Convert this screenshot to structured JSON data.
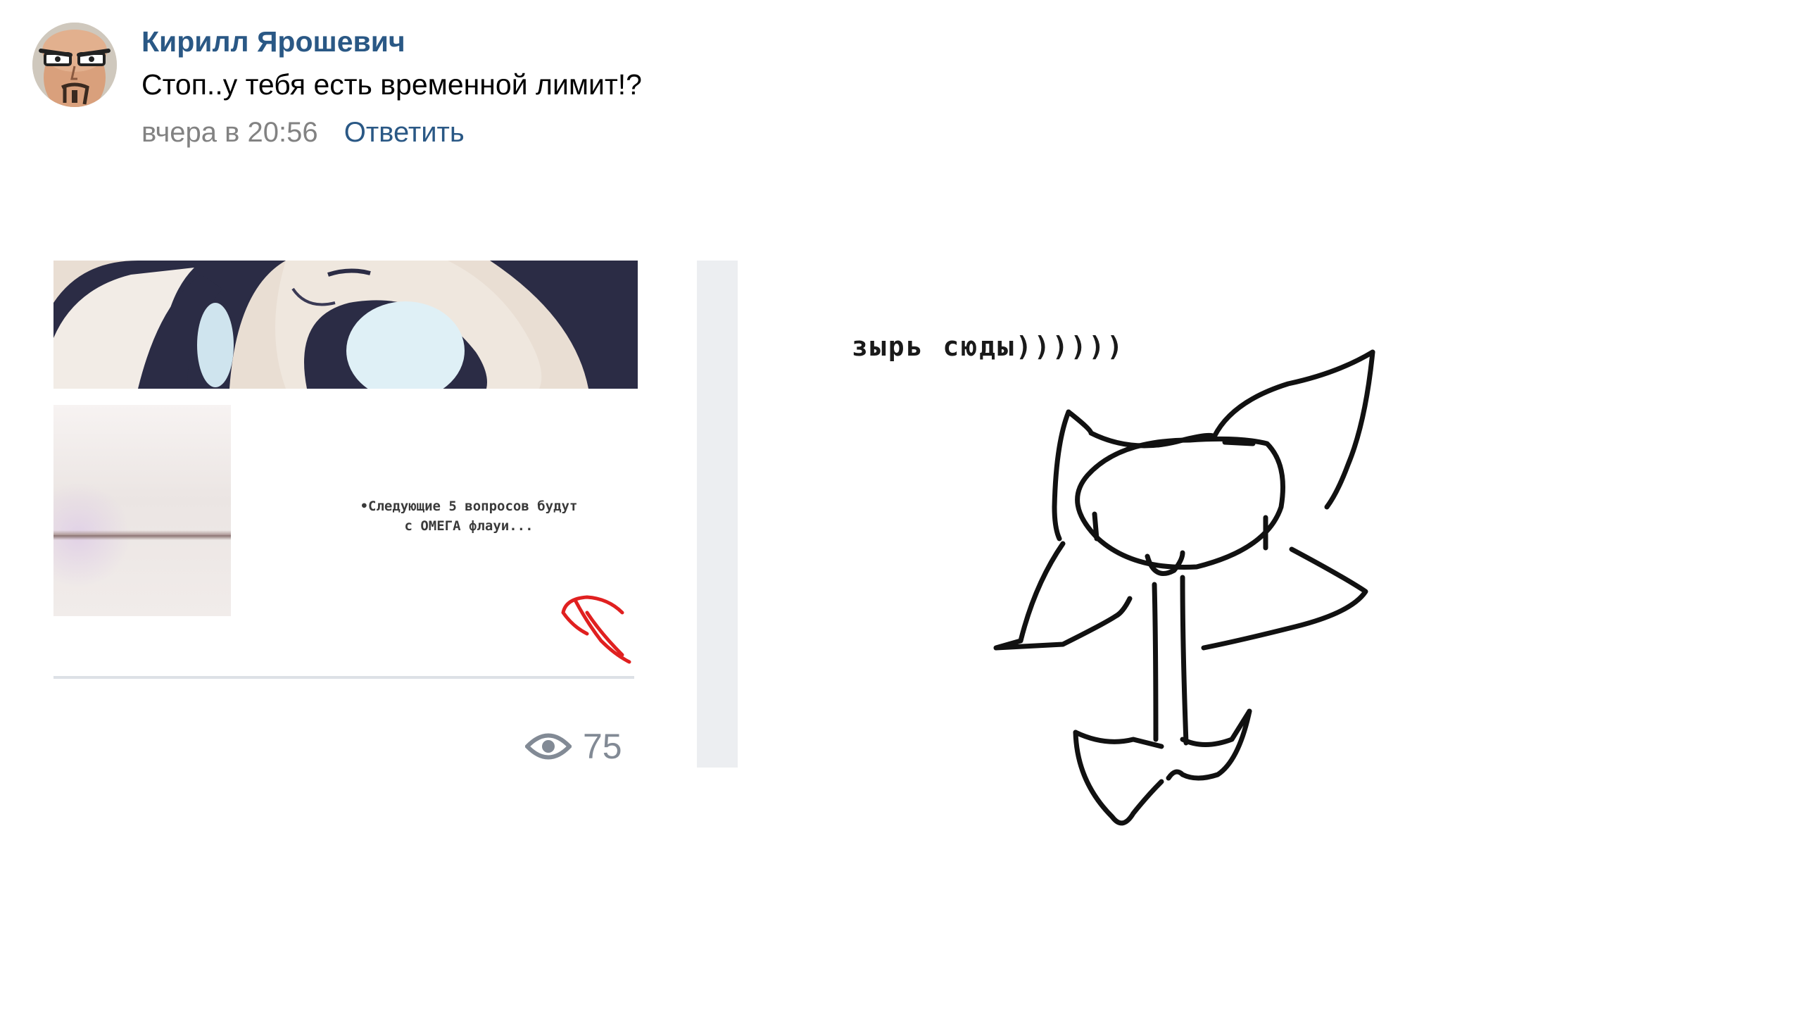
{
  "comment": {
    "author": "Кирилл Ярошевич",
    "text": "Стоп..у тебя есть временной лимит!?",
    "time": "вчера в 20:56",
    "reply_label": "Ответить",
    "avatar_icon": "avatar-bald-mustache-man"
  },
  "screenshot": {
    "caption": "•Следующие 5 вопросов будут\nс ОМЕГА флауи...",
    "views_icon": "eye-icon",
    "views_count": "75",
    "arrow_color": "#e02020"
  },
  "drawing": {
    "text": "зырь сюды))))))",
    "subject": "flower-doodle"
  },
  "colors": {
    "link": "#2a5885",
    "muted": "#828282",
    "views": "#828a95"
  }
}
